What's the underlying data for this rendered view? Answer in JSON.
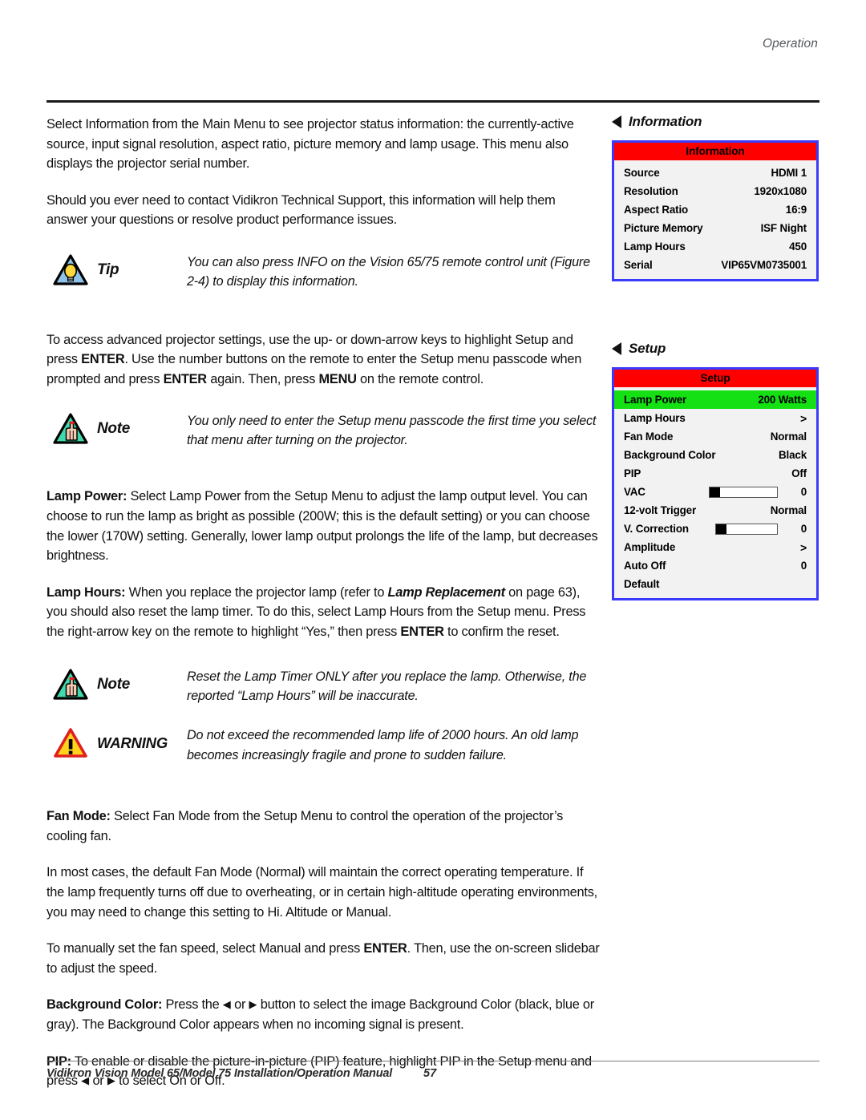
{
  "header": {
    "section": "Operation"
  },
  "footer": {
    "manual": "Vidikron Vision Model 65/Model 75 Installation/Operation Manual",
    "page": "57"
  },
  "body": {
    "p1": "Select Information from the Main Menu to see projector status information: the currently-active source, input signal resolution, aspect ratio, picture memory and lamp usage. This menu also displays the projector serial number.",
    "p2": "Should you ever need to contact Vidikron Technical Support, this information will help them answer your questions or resolve product performance issues.",
    "tip1": {
      "label": "Tip",
      "text": "You can also press INFO on the Vision 65/75 remote control unit (Figure 2-4) to display this information."
    },
    "p3_a": "To access advanced projector settings, use the up- or down-arrow keys to highlight Setup and press ",
    "p3_b": "ENTER",
    "p3_c": ". Use the number buttons on the remote to enter the Setup menu passcode when prompted and press ",
    "p3_d": "ENTER",
    "p3_e": " again. Then, press ",
    "p3_f": "MENU",
    "p3_g": " on the remote control.",
    "note1": {
      "label": "Note",
      "text": "You only need to enter the Setup menu passcode the first time you select that menu after turning on the projector."
    },
    "p4_head": "Lamp Power:",
    "p4_rest": " Select Lamp Power from the Setup Menu to adjust the lamp output level. You can choose to run the lamp as bright as possible (200W; this is the default setting) or you can choose the lower (170W) setting. Generally, lower lamp output prolongs the life of the lamp, but decreases brightness.",
    "p5_head": "Lamp Hours:",
    "p5_a": " When you replace the projector lamp (refer to ",
    "p5_ital": "Lamp Replacement",
    "p5_b": " on page 63), you should also reset the lamp timer. To do this, select Lamp Hours from the Setup menu. Press the right-arrow key on the remote to highlight “Yes,” then press ",
    "p5_bold": "ENTER",
    "p5_c": " to confirm the reset.",
    "note2": {
      "label": "Note",
      "text": "Reset the Lamp Timer ONLY after you replace the lamp. Otherwise, the reported “Lamp Hours” will be inaccurate."
    },
    "warning1": {
      "label": "WARNING",
      "text": "Do not exceed the recommended lamp life of 2000 hours. An old lamp becomes increasingly fragile and prone to sudden failure."
    },
    "p6_head": "Fan Mode:",
    "p6_rest": " Select Fan Mode from the Setup Menu to control the operation of the projector’s cooling fan.",
    "p7": "In most cases, the default Fan Mode (Normal) will maintain the correct operating temperature. If the lamp frequently turns off due to overheating, or in certain high-altitude operating environments, you may need to change this setting to Hi. Altitude or Manual.",
    "p8_a": "To manually set the fan speed, select Manual and press ",
    "p8_bold": "ENTER",
    "p8_b": ". Then, use the on-screen slidebar to adjust the speed.",
    "p9_head": "Background Color:",
    "p9_a": " Press the ",
    "p9_left": "◀",
    "p9_or": " or ",
    "p9_right": "▶",
    "p9_b": " button to select the image Background Color (black, blue or gray). The Background Color appears when no incoming signal is present.",
    "p10_head": "PIP:",
    "p10_a": " To enable or disable the picture-in-picture (PIP) feature, highlight PIP in the Setup menu and press ",
    "p10_left": "◀",
    "p10_or": " or ",
    "p10_right": "▶",
    "p10_b": " to select On or Off."
  },
  "osd": {
    "colors": {
      "border": "#3a3aff",
      "title_bar": "#fe0000",
      "body": "#f2f2f2",
      "highlight": "#14e014"
    },
    "information": {
      "heading": "Information",
      "title": "Information",
      "rows": [
        {
          "label": "Source",
          "value": "HDMI 1"
        },
        {
          "label": "Resolution",
          "value": "1920x1080"
        },
        {
          "label": "Aspect Ratio",
          "value": "16:9"
        },
        {
          "label": "Picture Memory",
          "value": "ISF Night"
        },
        {
          "label": "Lamp Hours",
          "value": "450"
        },
        {
          "label": "Serial",
          "value": "VIP65VM0735001"
        }
      ]
    },
    "setup": {
      "heading": "Setup",
      "title": "Setup",
      "rows": [
        {
          "label": "Lamp Power",
          "value": "200 Watts",
          "highlight": true
        },
        {
          "label": "Lamp Hours",
          "value": ">"
        },
        {
          "label": "Fan Mode",
          "value": "Normal"
        },
        {
          "label": "Background Color",
          "value": "Black"
        },
        {
          "label": "PIP",
          "value": "Off"
        },
        {
          "label": "VAC",
          "value": "0",
          "slider": 0
        },
        {
          "label": "12-volt Trigger",
          "value": "Normal"
        },
        {
          "label": "V. Correction",
          "value": "0",
          "slider": 0
        },
        {
          "label": "Amplitude",
          "value": ">"
        },
        {
          "label": "Auto Off",
          "value": "0"
        },
        {
          "label": "Default",
          "value": ""
        }
      ]
    }
  }
}
